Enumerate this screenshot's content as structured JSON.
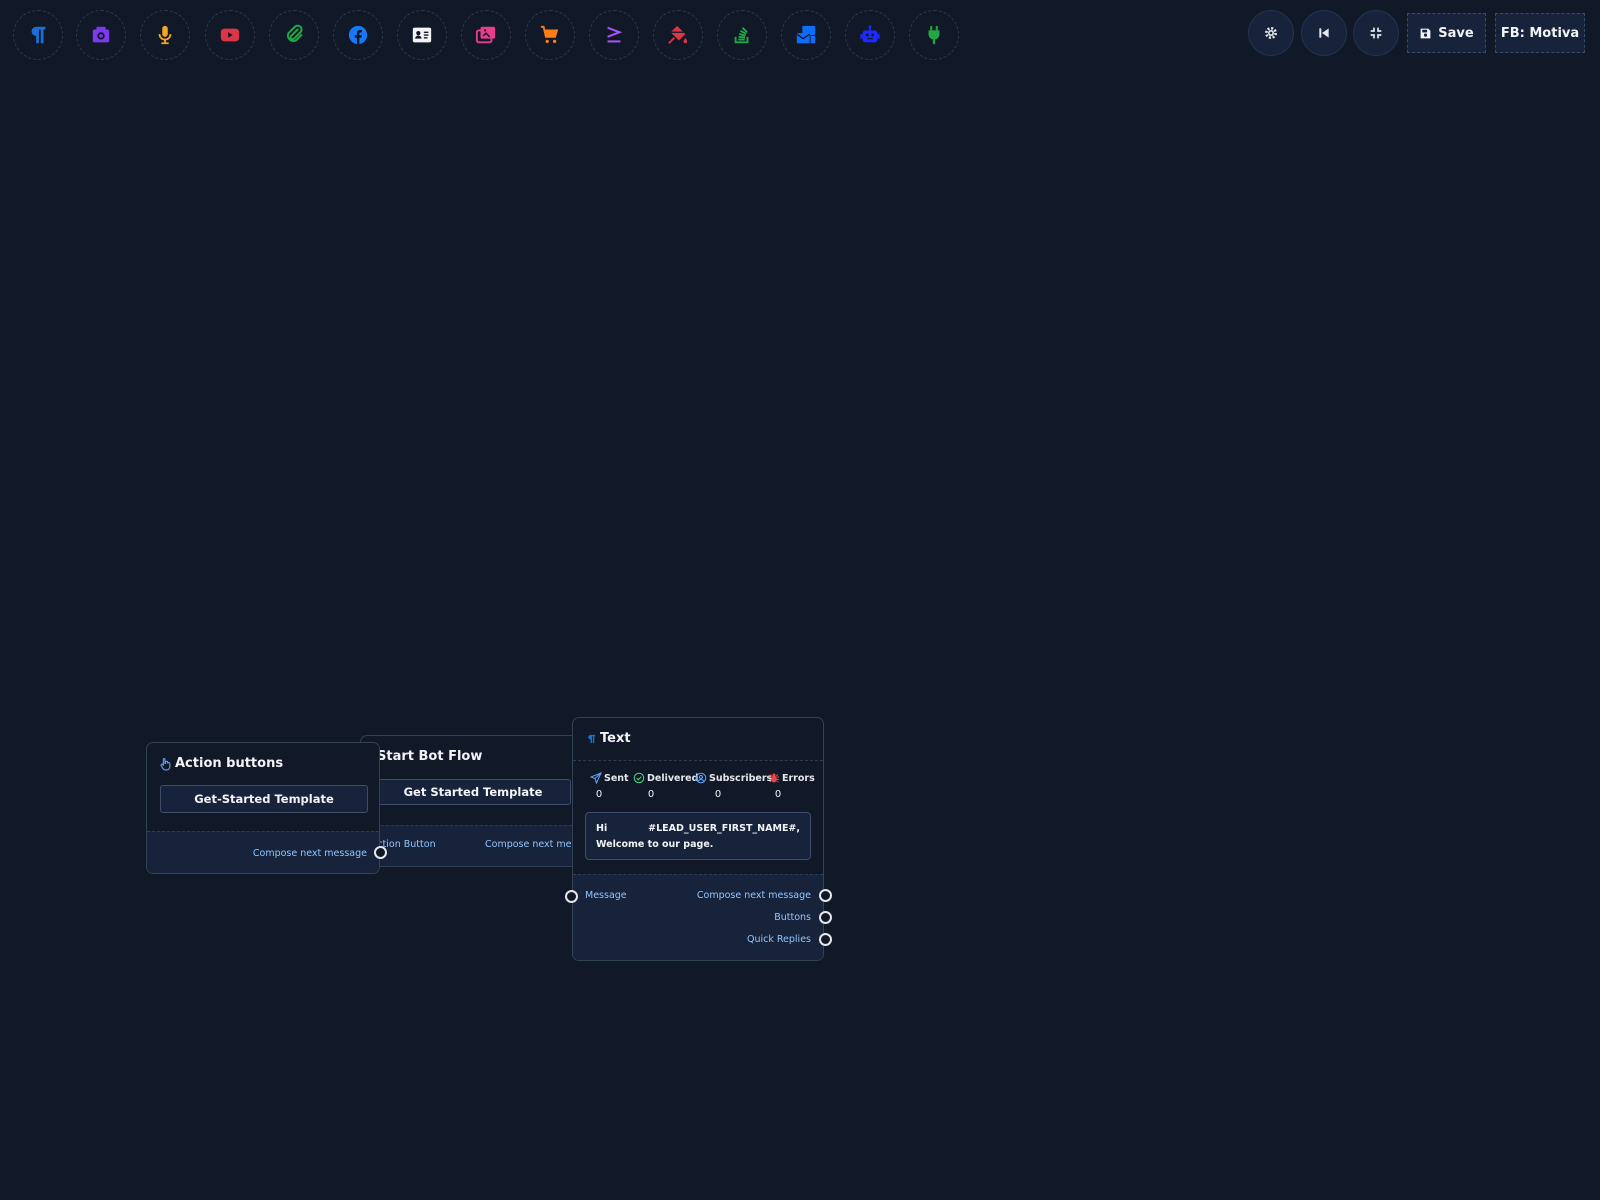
{
  "toolbar": {
    "tools": [
      {
        "icon": "paragraph-icon",
        "color": "#1d6fd8"
      },
      {
        "icon": "camera-icon",
        "color": "#7c3aed"
      },
      {
        "icon": "microphone-icon",
        "color": "#f5a524"
      },
      {
        "icon": "youtube-icon",
        "color": "#dc3545"
      },
      {
        "icon": "paperclip-icon",
        "color": "#22a845"
      },
      {
        "icon": "facebook-icon",
        "color": "#1877f2"
      },
      {
        "icon": "contact-card-icon",
        "color": "#f3f4f6"
      },
      {
        "icon": "images-icon",
        "color": "#e83e8c"
      },
      {
        "icon": "cart-icon",
        "color": "#fd7e14"
      },
      {
        "icon": "greater-equal-icon",
        "color": "#a855f7"
      },
      {
        "icon": "paint-bucket-icon",
        "color": "#dc3545"
      },
      {
        "icon": "stack-overflow-icon",
        "color": "#22a845"
      },
      {
        "icon": "mail-bulk-icon",
        "color": "#0d6efd"
      },
      {
        "icon": "robot-icon",
        "color": "#1e2bff"
      },
      {
        "icon": "plug-icon",
        "color": "#22a845"
      }
    ],
    "save_label": "Save",
    "account_label": "FB: Motiva"
  },
  "nodes": {
    "action_buttons": {
      "title": "Action buttons",
      "template_label": "Get-Started Template",
      "output_label": "Compose next message"
    },
    "start_bot_flow": {
      "title": "Start Bot Flow",
      "template_label": "Get Started Template",
      "input_label": "Action Button",
      "output_label": "Compose next message"
    },
    "text": {
      "title": "Text",
      "stats": [
        {
          "label": "Sent",
          "value": "0",
          "icon": "paper-plane-icon",
          "color": "#60a5fa"
        },
        {
          "label": "Delivered",
          "value": "0",
          "icon": "check-circle-icon",
          "color": "#4ade80"
        },
        {
          "label": "Subscribers",
          "value": "0",
          "icon": "user-circle-icon",
          "color": "#60a5fa"
        },
        {
          "label": "Errors",
          "value": "0",
          "icon": "bug-icon",
          "color": "#ef4444"
        }
      ],
      "message": "Hi #LEAD_USER_FIRST_NAME#, Welcome to our page.",
      "input_label": "Message",
      "outputs": [
        "Compose next message",
        "Buttons",
        "Quick Replies"
      ]
    }
  }
}
